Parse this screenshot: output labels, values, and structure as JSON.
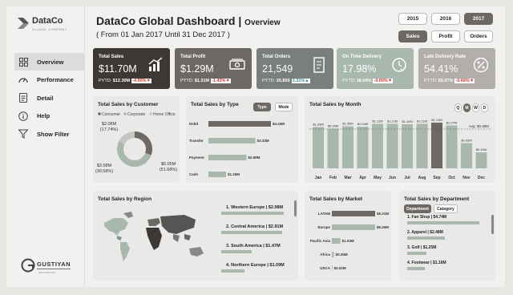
{
  "brand": {
    "name": "DataCo",
    "sub": "GLOBAL COMPANY",
    "footer_name": "GUSTIYAN",
    "footer_sub": "DATA ANALYST"
  },
  "nav": [
    {
      "label": "Overview",
      "active": true,
      "icon": "grid-icon"
    },
    {
      "label": "Performance",
      "active": false,
      "icon": "gauge-icon"
    },
    {
      "label": "Detail",
      "active": false,
      "icon": "document-icon"
    },
    {
      "label": "Help",
      "active": false,
      "icon": "info-icon"
    },
    {
      "label": "Show Filter",
      "active": false,
      "icon": "filter-icon"
    }
  ],
  "header": {
    "title": "DataCo Global Dashboard |",
    "subtitle": "Overview",
    "daterange": "( From 01 Jan 2017 Until 31 Dec 2017 )"
  },
  "years": [
    {
      "label": "2015",
      "on": false
    },
    {
      "label": "2016",
      "on": false
    },
    {
      "label": "2017",
      "on": true
    }
  ],
  "metrics": [
    {
      "label": "Sales",
      "on": true
    },
    {
      "label": "Profit",
      "on": false
    },
    {
      "label": "Orders",
      "on": false
    }
  ],
  "kpis": [
    {
      "label": "Total Sales",
      "value": "$11.70M",
      "py_label": "PYTD:",
      "py": "$12.30M",
      "change": "-4.90%",
      "dir": "neg",
      "arrow": "▼",
      "color": "#3d3836",
      "icon": "chart-icon"
    },
    {
      "label": "Total Profit",
      "value": "$1.29M",
      "py_label": "PYTD:",
      "py": "$1.31M",
      "change": "-1.43%",
      "dir": "neg",
      "arrow": "▼",
      "color": "#6e6864",
      "icon": "money-icon"
    },
    {
      "label": "Total Orders",
      "value": "21,549",
      "py_label": "PYTD:",
      "py": "20,859",
      "change": "3.31%",
      "dir": "pos",
      "arrow": "▲",
      "color": "#7a7f7c",
      "icon": "receipt-icon"
    },
    {
      "label": "On Time Delivery",
      "value": "17.98%",
      "py_label": "PYTD:",
      "py": "18.04%",
      "change": "-0.05%",
      "dir": "neg",
      "arrow": "▼",
      "color": "#a8b8ae",
      "icon": "clock-check-icon"
    },
    {
      "label": "Late Delivery Rate",
      "value": "54.41%",
      "py_label": "PYTD:",
      "py": "55.07%",
      "change": "-0.66%",
      "dir": "neg",
      "arrow": "▼",
      "color": "#b1aeab",
      "icon": "percent-icon"
    }
  ],
  "customer": {
    "title": "Total Sales by Customer",
    "legend": [
      "Consumer",
      "Corporate",
      "Home Office"
    ],
    "colors": [
      "#6e6864",
      "#a8b8ae",
      "#c5c5c3"
    ],
    "labels": [
      {
        "value": "$2.08M",
        "pct": "(17.74%)"
      },
      {
        "value": "$3.58M",
        "pct": "(30.58%)"
      },
      {
        "value": "$6.05M",
        "pct": "(51.68%)"
      }
    ]
  },
  "type_chart": {
    "title": "Total Sales by Type",
    "toggles": [
      {
        "label": "Type",
        "on": true
      },
      {
        "label": "Mode",
        "on": false
      }
    ],
    "items": [
      {
        "label": "Debit",
        "value": 4.43,
        "text": "$4.43M"
      },
      {
        "label": "Transfer",
        "value": 3.33,
        "text": "$3.33M"
      },
      {
        "label": "Payment",
        "value": 2.69,
        "text": "$2.69M"
      },
      {
        "label": "Cash",
        "value": 1.25,
        "text": "$1.25M"
      }
    ]
  },
  "month_chart": {
    "title": "Total Sales by Month",
    "toggles": [
      {
        "label": "Q",
        "on": false
      },
      {
        "label": "M",
        "on": true
      },
      {
        "label": "W",
        "on": false
      },
      {
        "label": "D",
        "on": false
      }
    ],
    "avg_label": "Avg: $0.98M",
    "avg": 0.98,
    "months": [
      "Jan",
      "Feb",
      "Mar",
      "Apr",
      "May",
      "Jun",
      "Jul",
      "Aug",
      "Sep",
      "Oct",
      "Nov",
      "Dec"
    ],
    "values": [
      1.03,
      0.99,
      1.05,
      1.04,
      1.11,
      1.11,
      1.1,
      1.11,
      1.14,
      1.07,
      0.63,
      0.4
    ],
    "texts": [
      "$1.03M",
      "$0.99M",
      "$1.05M",
      "$1.04M",
      "$1.11M",
      "$1.11M",
      "$1.10M",
      "$1.11M",
      "$1.14M",
      "$1.07M",
      "$0.63M",
      "$0.40M"
    ]
  },
  "region": {
    "title": "Total Sales by Region",
    "items": [
      "1. Western Europe | $2.98M",
      "2. Central America | $2.91M",
      "3. South America | $1.47M",
      "4. Northern Europe | $1.09M"
    ],
    "values": [
      2.98,
      2.91,
      1.47,
      1.09
    ]
  },
  "market": {
    "title": "Total Sales by Market",
    "items": [
      {
        "label": "LATAM",
        "value": 5.21,
        "text": "$5.21M"
      },
      {
        "label": "Europe",
        "value": 5.2,
        "text": "$5.20M"
      },
      {
        "label": "Pacific Asia",
        "value": 1.03,
        "text": "$1.03M"
      },
      {
        "label": "Africa",
        "value": 0.25,
        "text": "$0.25M"
      },
      {
        "label": "USCA",
        "value": 0.02,
        "text": "$0.02M"
      }
    ]
  },
  "department": {
    "title": "Total Sales by Department",
    "toggles": [
      {
        "label": "Department",
        "on": true
      },
      {
        "label": "Category",
        "on": false
      }
    ],
    "items": [
      {
        "label": "1. Fan Shop | $4.74M",
        "value": 4.74
      },
      {
        "label": "2. Apparel | $2.48M",
        "value": 2.48
      },
      {
        "label": "3. Golf | $1.25M",
        "value": 1.25
      },
      {
        "label": "4. Footwear | $1.16M",
        "value": 1.16
      }
    ]
  }
}
